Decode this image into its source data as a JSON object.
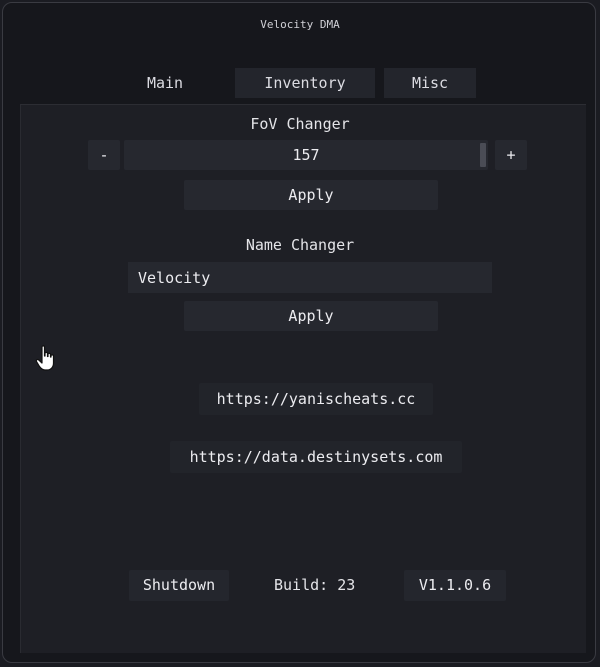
{
  "window": {
    "title": "Velocity DMA"
  },
  "tabs": [
    {
      "label": "Main"
    },
    {
      "label": "Inventory"
    },
    {
      "label": "Misc"
    }
  ],
  "fov": {
    "heading": "FoV Changer",
    "minus_label": "-",
    "plus_label": "+",
    "value": "157",
    "apply_label": "Apply"
  },
  "name": {
    "heading": "Name Changer",
    "value": "Velocity",
    "apply_label": "Apply"
  },
  "links": {
    "site": "https://yanischeats.cc",
    "data": "https://data.destinysets.com"
  },
  "footer": {
    "shutdown_label": "Shutdown",
    "build": "Build: 23",
    "version": "V1.1.0.6"
  },
  "colors": {
    "background": "#16171c",
    "panel": "#1e1f25",
    "widget": "#26282f",
    "text": "#e4e4e8"
  }
}
